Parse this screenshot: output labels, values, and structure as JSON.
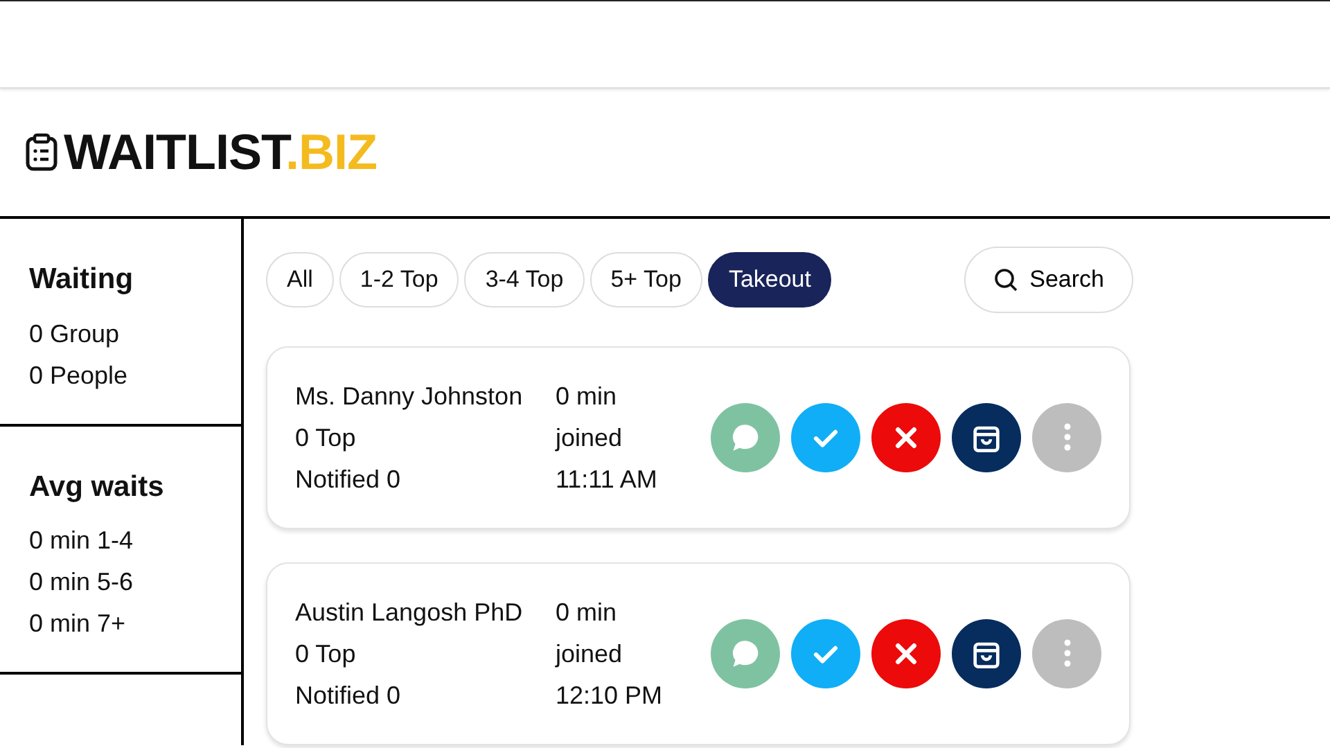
{
  "logo": {
    "text": "WAITLIST",
    "accent": ".BIZ"
  },
  "sidebar": [
    {
      "title": "Waiting",
      "lines": [
        "0 Group",
        "0 People"
      ]
    },
    {
      "title": "Avg waits",
      "lines": [
        "0 min 1-4",
        "0 min 5-6",
        "0 min 7+"
      ]
    }
  ],
  "filters": [
    {
      "label": "All",
      "selected": false
    },
    {
      "label": "1-2 Top",
      "selected": false
    },
    {
      "label": "3-4 Top",
      "selected": false
    },
    {
      "label": "5+ Top",
      "selected": false
    },
    {
      "label": "Takeout",
      "selected": true
    }
  ],
  "search": {
    "label": "Search"
  },
  "entries": [
    {
      "name": "Ms. Danny Johnston",
      "wait": "0 min",
      "party": "0 Top",
      "joined_label": "joined",
      "notified": "Notified 0",
      "time": "11:11 AM"
    },
    {
      "name": "Austin Langosh PhD",
      "wait": "0 min",
      "party": "0 Top",
      "joined_label": "joined",
      "notified": "Notified 0",
      "time": "12:10 PM"
    }
  ],
  "actions": [
    {
      "kind": "message"
    },
    {
      "kind": "seat"
    },
    {
      "kind": "remove"
    },
    {
      "kind": "takeout"
    },
    {
      "kind": "more"
    }
  ]
}
